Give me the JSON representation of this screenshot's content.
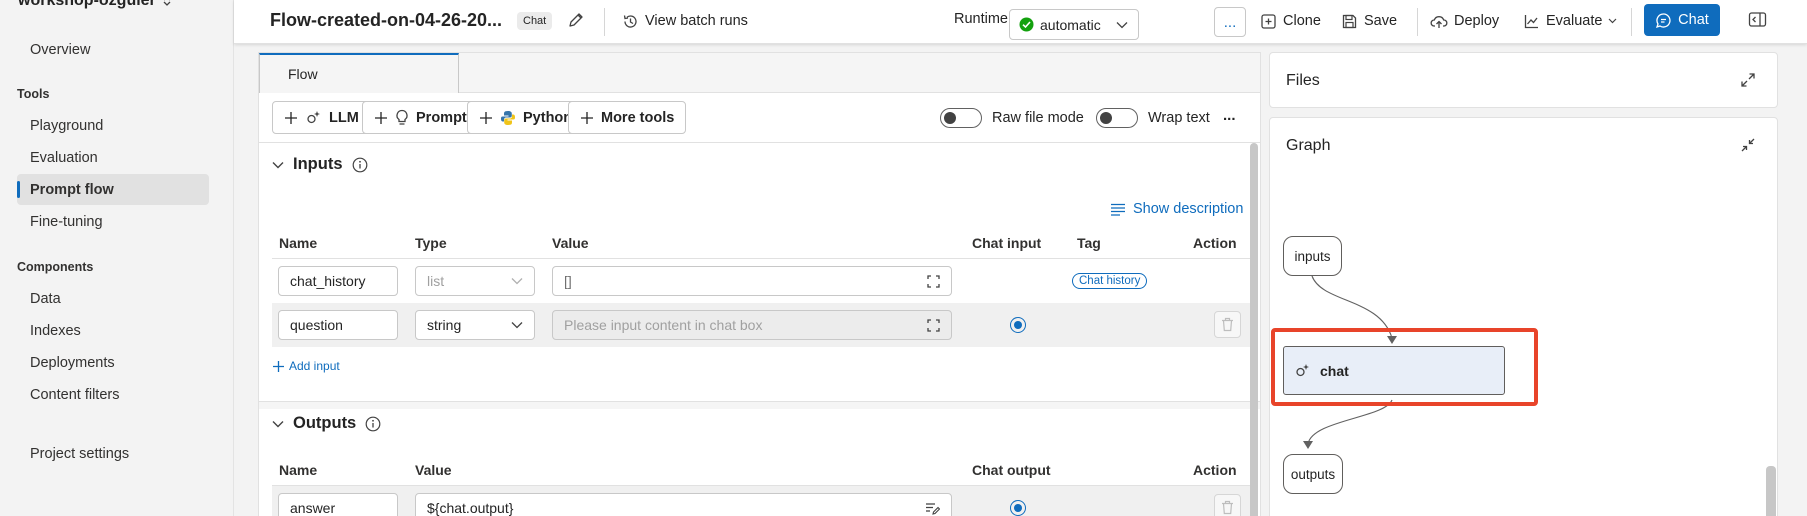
{
  "nav": {
    "project_name": "workshop-ozguler",
    "items_top": [
      {
        "label": "Overview"
      }
    ],
    "tools_title": "Tools",
    "tools": [
      {
        "label": "Playground"
      },
      {
        "label": "Evaluation"
      },
      {
        "label": "Prompt flow"
      },
      {
        "label": "Fine-tuning"
      }
    ],
    "components_title": "Components",
    "components": [
      {
        "label": "Data"
      },
      {
        "label": "Indexes"
      },
      {
        "label": "Deployments"
      },
      {
        "label": "Content filters"
      }
    ],
    "settings": "Project settings",
    "active_item": "Prompt flow"
  },
  "topbar": {
    "flow_title": "Flow-created-on-04-26-20...",
    "flow_badge": "Chat",
    "view_batch_runs": "View batch runs",
    "runtime_label": "Runtime",
    "runtime_required": "*",
    "runtime_value": "automatic",
    "more": "...",
    "clone": "Clone",
    "save": "Save",
    "deploy": "Deploy",
    "evaluate": "Evaluate",
    "chat": "Chat"
  },
  "editor": {
    "tab": "Flow",
    "tools": {
      "llm": "LLM",
      "prompt": "Prompt",
      "python": "Python",
      "more_tools": "More tools"
    },
    "raw_file_mode": "Raw file mode",
    "wrap_text": "Wrap text",
    "more": "...",
    "inputs": {
      "title": "Inputs",
      "show_description": "Show description",
      "columns": {
        "name": "Name",
        "type": "Type",
        "value": "Value",
        "chat_input": "Chat input",
        "tag": "Tag",
        "action": "Action"
      },
      "rows": [
        {
          "name": "chat_history",
          "type": "list",
          "value": "[]",
          "tag": "Chat history",
          "chat_input": false
        },
        {
          "name": "question",
          "type": "string",
          "value_placeholder": "Please input content in chat box",
          "chat_input": true
        }
      ],
      "add_input": "Add input"
    },
    "outputs": {
      "title": "Outputs",
      "columns": {
        "name": "Name",
        "value": "Value",
        "chat_output": "Chat output",
        "action": "Action"
      },
      "rows": [
        {
          "name": "answer",
          "value": "${chat.output}",
          "chat_output": true
        }
      ]
    }
  },
  "files_panel": {
    "title": "Files"
  },
  "graph_panel": {
    "title": "Graph",
    "nodes": {
      "inputs": "inputs",
      "chat": "chat",
      "outputs": "outputs"
    }
  },
  "colors": {
    "accent": "#0f6cbd",
    "highlight": "#e8442a",
    "node_fill": "#e8eef8",
    "success": "#13a10e"
  }
}
